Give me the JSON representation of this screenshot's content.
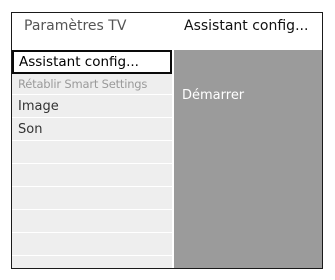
{
  "header": {
    "left_title": "Paramètres TV",
    "right_title": "Assistant config..."
  },
  "menu": {
    "items": [
      {
        "label": "Assistant config...",
        "state": "selected"
      },
      {
        "label": "Rétablir Smart Settings",
        "state": "disabled"
      },
      {
        "label": "Image",
        "state": "normal"
      },
      {
        "label": "Son",
        "state": "normal"
      },
      {
        "label": "",
        "state": "empty"
      },
      {
        "label": "",
        "state": "empty"
      },
      {
        "label": "",
        "state": "empty"
      },
      {
        "label": "",
        "state": "empty"
      },
      {
        "label": "",
        "state": "empty"
      }
    ]
  },
  "submenu": {
    "items": [
      {
        "label": "Démarrer"
      }
    ]
  },
  "colors": {
    "left_background": "#eeeeee",
    "right_background": "#9b9b9b",
    "selection_border": "#0a0a0a"
  }
}
